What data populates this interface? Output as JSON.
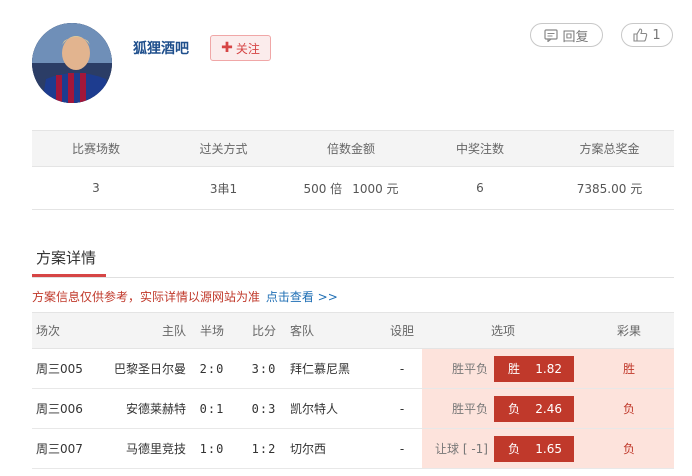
{
  "header": {
    "username": "狐狸酒吧",
    "follow_label": "关注",
    "reply_label": "回复",
    "like_count": "1"
  },
  "summary": {
    "headers": [
      "比赛场数",
      "过关方式",
      "倍数金额",
      "中奖注数",
      "方案总奖金"
    ],
    "values": {
      "matches": "3",
      "pass_type": "3串1",
      "multiple": "500 倍",
      "amount": "1000 元",
      "winning_bets": "6",
      "total_prize": "7385.00 元"
    }
  },
  "section": {
    "title": "方案详情",
    "notice": "方案信息仅供参考，实际详情以源网站为准",
    "notice_link": "点击查看 >>"
  },
  "detail": {
    "headers": {
      "round": "场次",
      "home": "主队",
      "half": "半场",
      "score": "比分",
      "away": "客队",
      "banker": "设胆",
      "option": "选项",
      "result": "彩果"
    },
    "rows": [
      {
        "round": "周三005",
        "home": "巴黎圣日尔曼",
        "half": "2:0",
        "score": "3:0",
        "away": "拜仁慕尼黑",
        "banker": "-",
        "option_type": "胜平负",
        "pick": "胜",
        "odds": "1.82",
        "result": "胜"
      },
      {
        "round": "周三006",
        "home": "安德莱赫特",
        "half": "0:1",
        "score": "0:3",
        "away": "凯尔特人",
        "banker": "-",
        "option_type": "胜平负",
        "pick": "负",
        "odds": "2.46",
        "result": "负"
      },
      {
        "round": "周三007",
        "home": "马德里竞技",
        "half": "1:0",
        "score": "1:2",
        "away": "切尔西",
        "banker": "-",
        "option_type": "让球 [ -1]",
        "pick": "负",
        "odds": "1.65",
        "result": "负"
      }
    ]
  }
}
